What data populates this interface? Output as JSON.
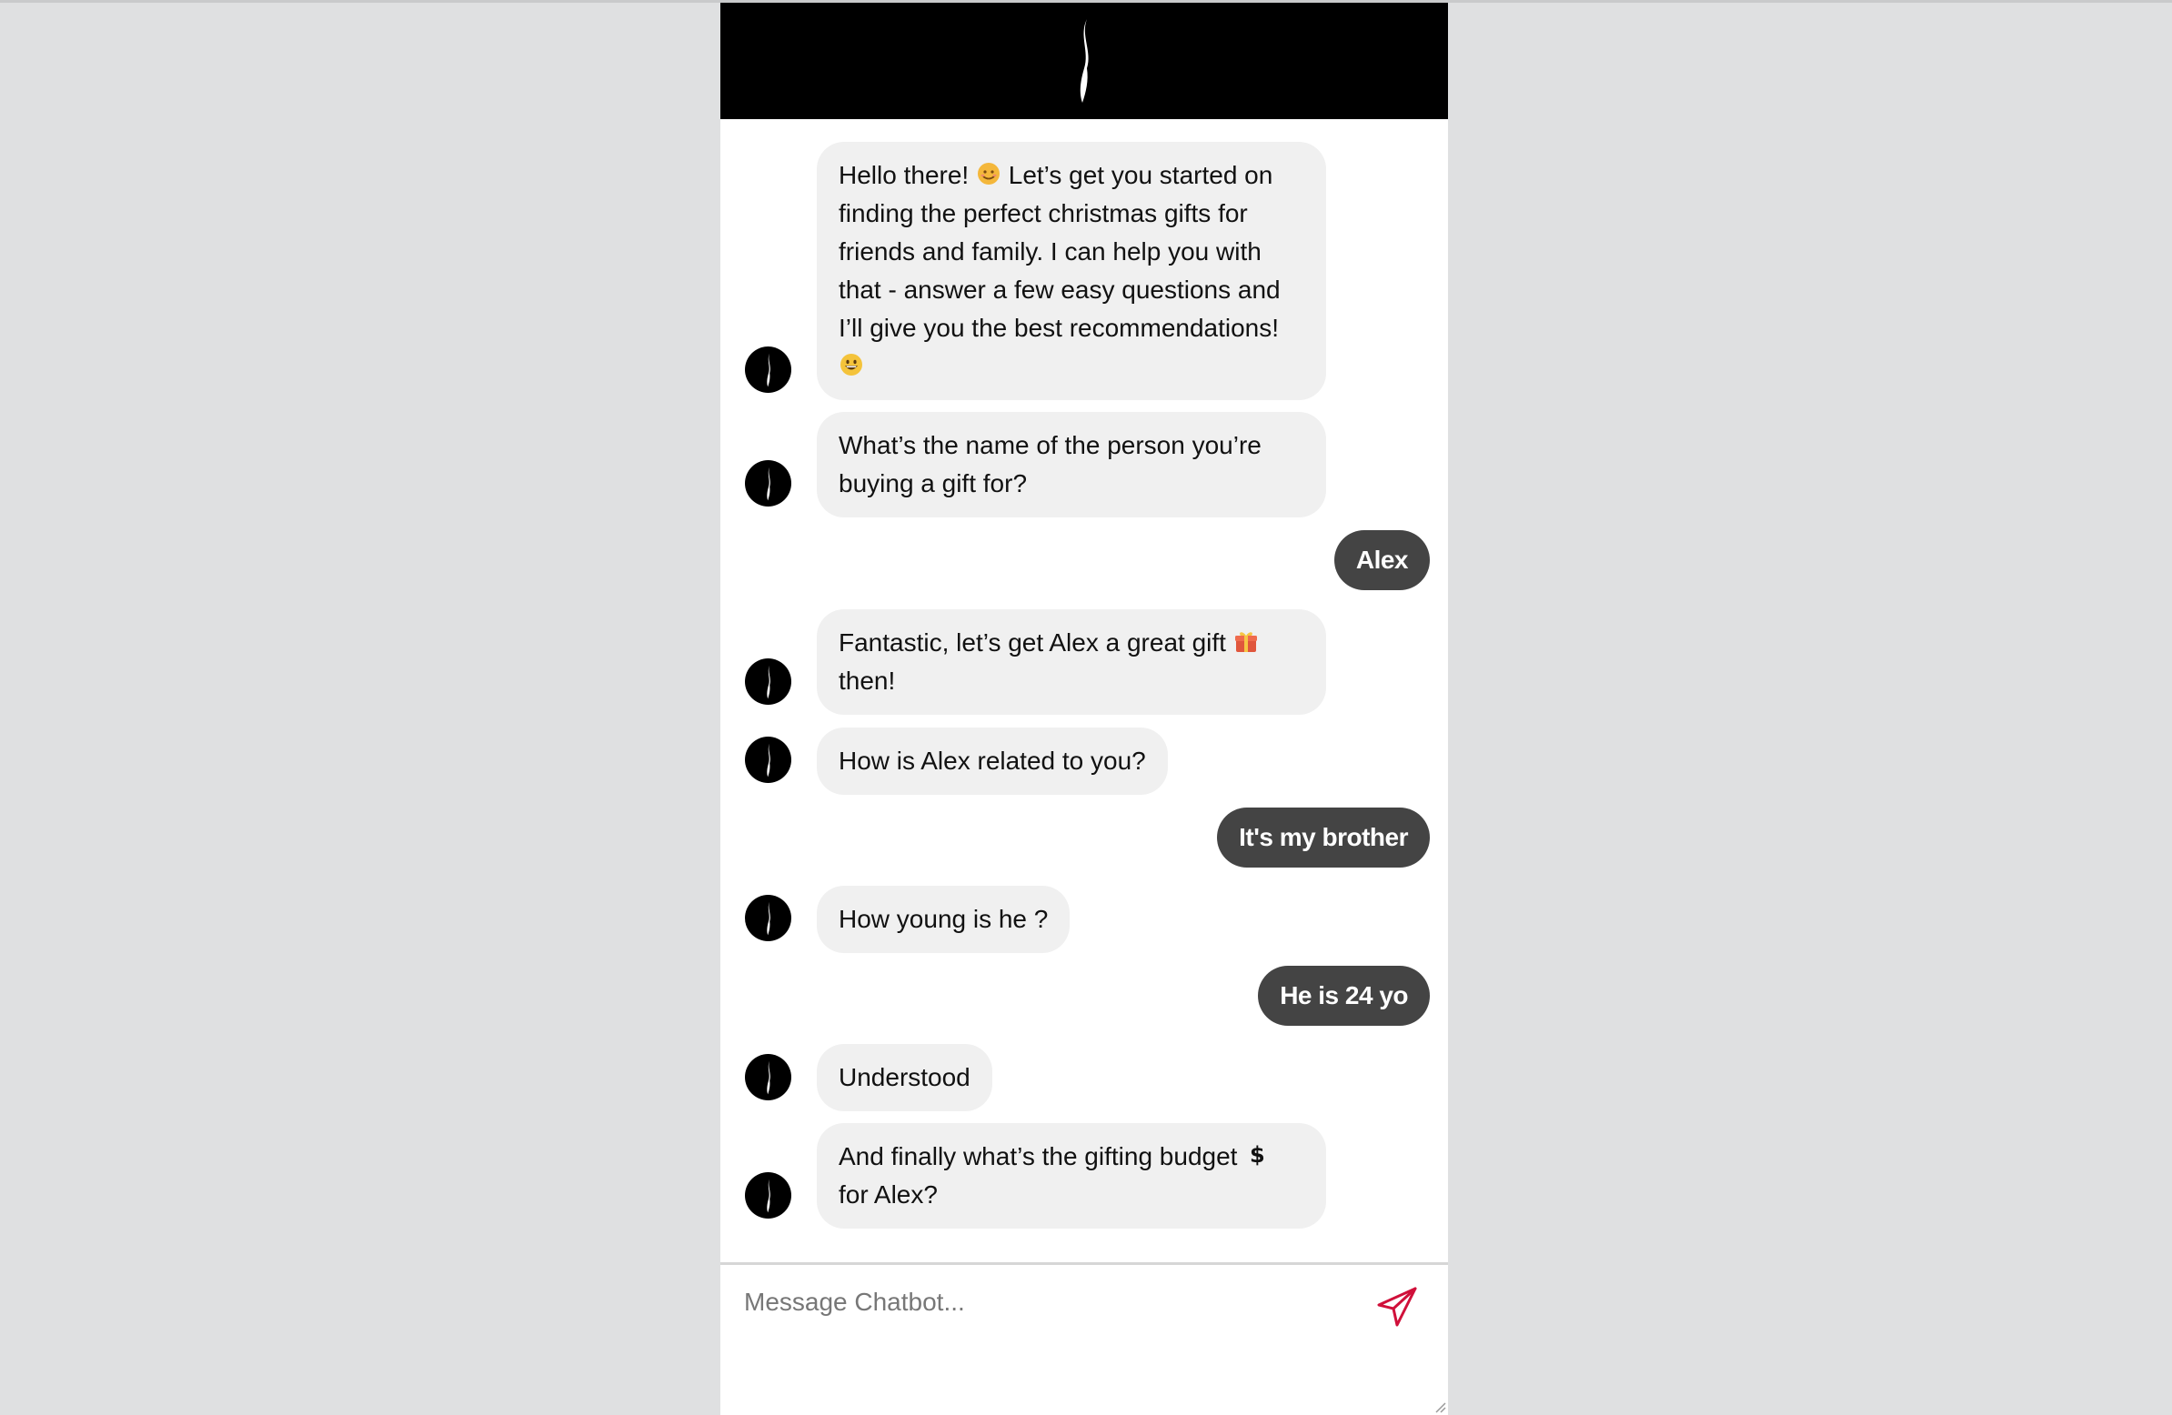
{
  "colors": {
    "page_background": "#dfe0e1",
    "header_background": "#000000",
    "bot_bubble": "#f0f0f0",
    "user_bubble": "#444444",
    "send_icon": "#d0103a"
  },
  "header": {
    "logo_icon": "brand-s-logo-icon"
  },
  "messages": [
    {
      "sender": "bot",
      "text": "Hello there! ",
      "emoji1": "smiling-face-icon",
      "text2": " Let’s get you started on finding the perfect christmas gifts for friends and family. I can help you with that - answer a few easy questions and I’ll give you the best recommendations! ",
      "emoji2": "grinning-face-icon"
    },
    {
      "sender": "bot",
      "text": "What’s the name of the person you’re buying a gift for?"
    },
    {
      "sender": "user",
      "text": "Alex"
    },
    {
      "sender": "bot",
      "text": "Fantastic, let’s get Alex a great gift ",
      "emoji1": "gift-icon",
      "text2": " then!"
    },
    {
      "sender": "bot",
      "text": "How is Alex related to you?"
    },
    {
      "sender": "user",
      "text": "It's my brother"
    },
    {
      "sender": "bot",
      "text": "How young is he ?"
    },
    {
      "sender": "user",
      "text": "He is 24 yo"
    },
    {
      "sender": "bot",
      "text": "Understood"
    },
    {
      "sender": "bot",
      "text": "And finally what’s the gifting budget ",
      "emoji1": "dollar-sign-icon",
      "text2": " for Alex?"
    }
  ],
  "composer": {
    "placeholder": "Message Chatbot...",
    "value": "",
    "send_icon": "paper-plane-icon"
  }
}
